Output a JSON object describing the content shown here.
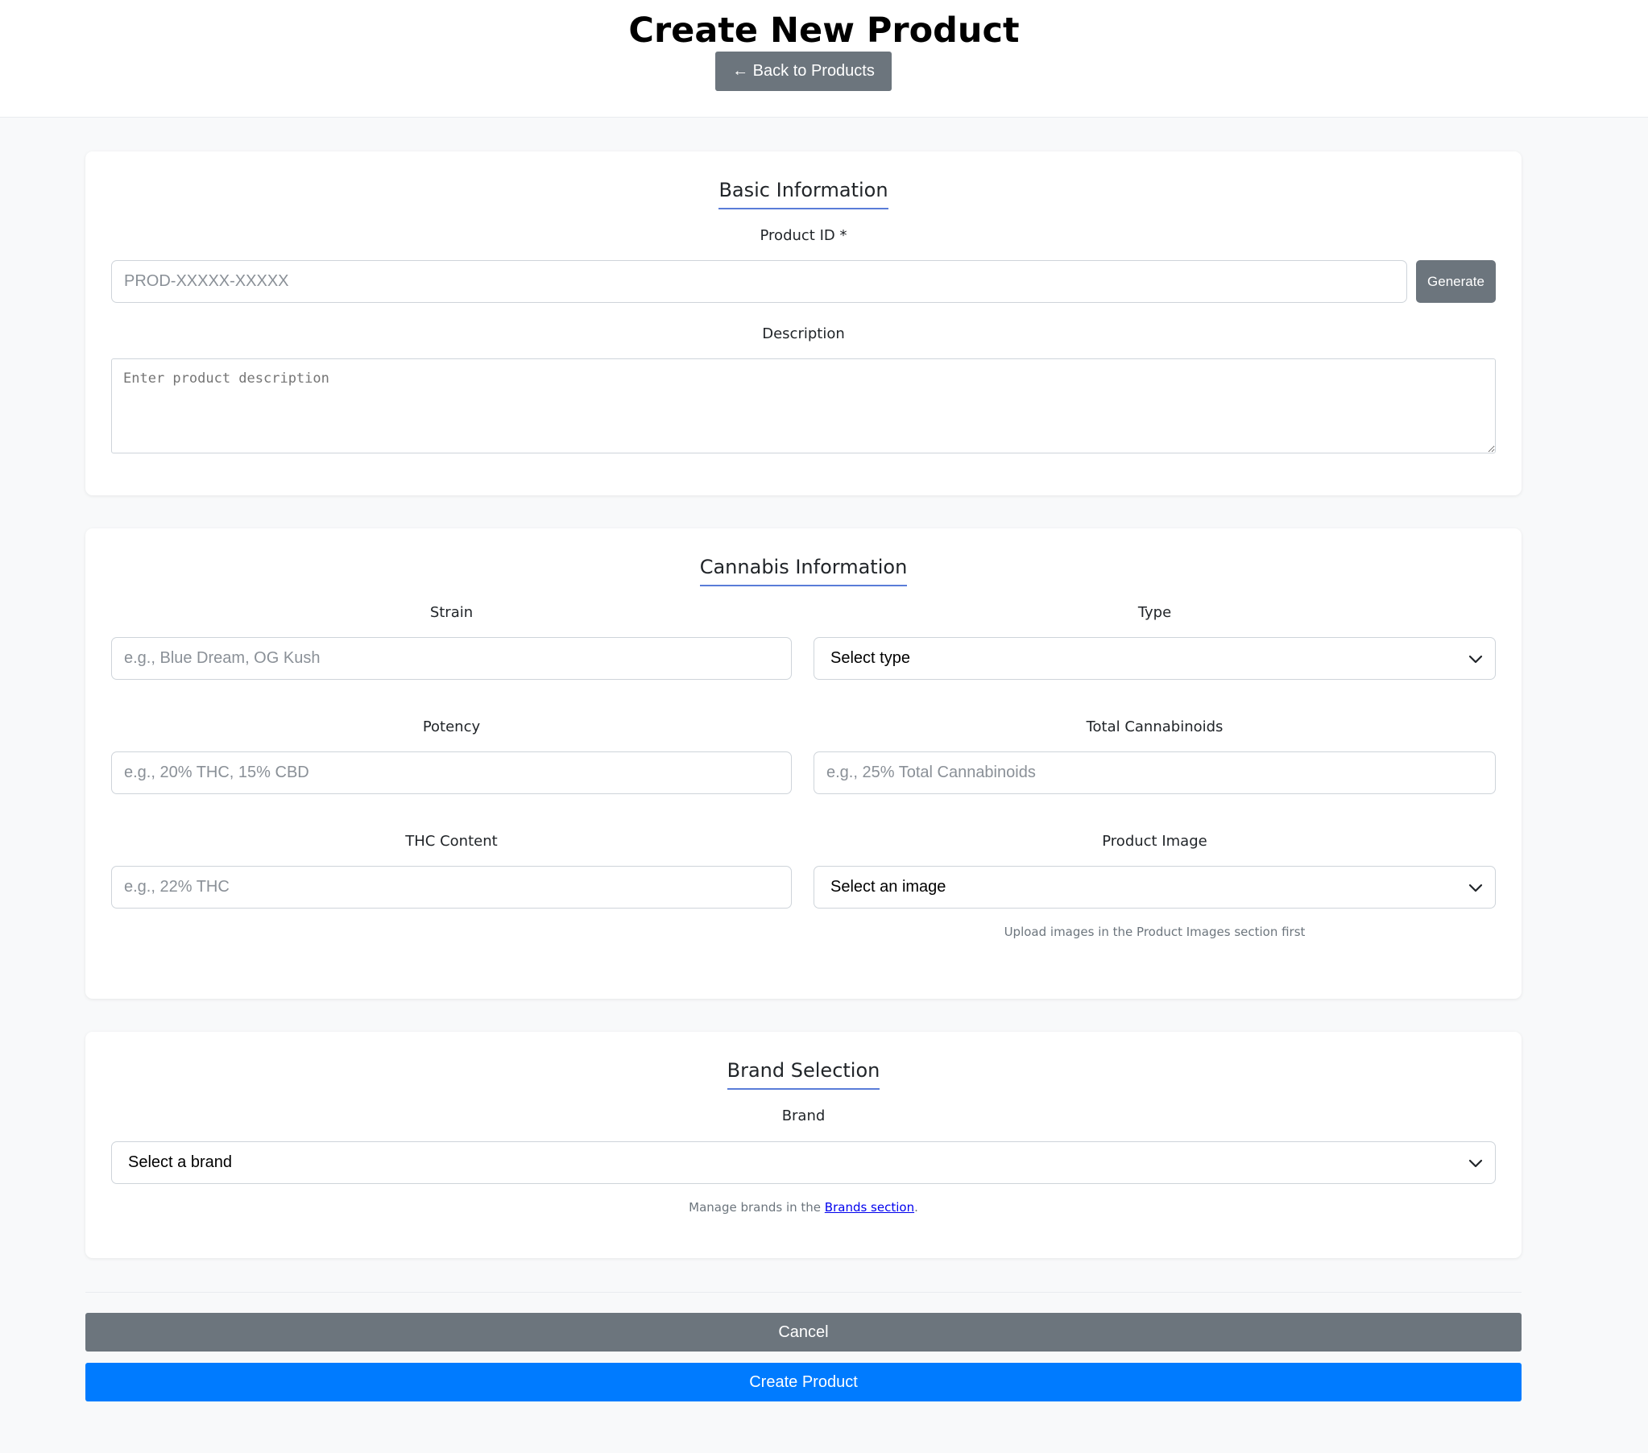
{
  "header": {
    "title": "Create New Product",
    "back_label": "← Back to Products"
  },
  "basic_info": {
    "title": "Basic Information",
    "product_id_label": "Product ID *",
    "product_id_placeholder": "PROD-XXXXX-XXXXX",
    "generate_label": "Generate",
    "description_label": "Description",
    "description_placeholder": "Enter product description"
  },
  "cannabis_info": {
    "title": "Cannabis Information",
    "strain_label": "Strain",
    "strain_placeholder": "e.g., Blue Dream, OG Kush",
    "type_label": "Type",
    "type_selected": "Select type",
    "potency_label": "Potency",
    "potency_placeholder": "e.g., 20% THC, 15% CBD",
    "total_cannabinoids_label": "Total Cannabinoids",
    "total_cannabinoids_placeholder": "e.g., 25% Total Cannabinoids",
    "thc_label": "THC Content",
    "thc_placeholder": "e.g., 22% THC",
    "image_label": "Product Image",
    "image_selected": "Select an image",
    "image_help": "Upload images in the Product Images section first"
  },
  "brand_selection": {
    "title": "Brand Selection",
    "brand_label": "Brand",
    "brand_selected": "Select a brand",
    "help_prefix": "Manage brands in the ",
    "help_link": "Brands section",
    "help_suffix": "."
  },
  "actions": {
    "cancel_label": "Cancel",
    "create_label": "Create Product"
  },
  "colors": {
    "secondary": "#6c757d",
    "primary": "#007bff",
    "accent_underline": "#5a7cd8",
    "background": "#f8f9fa"
  }
}
